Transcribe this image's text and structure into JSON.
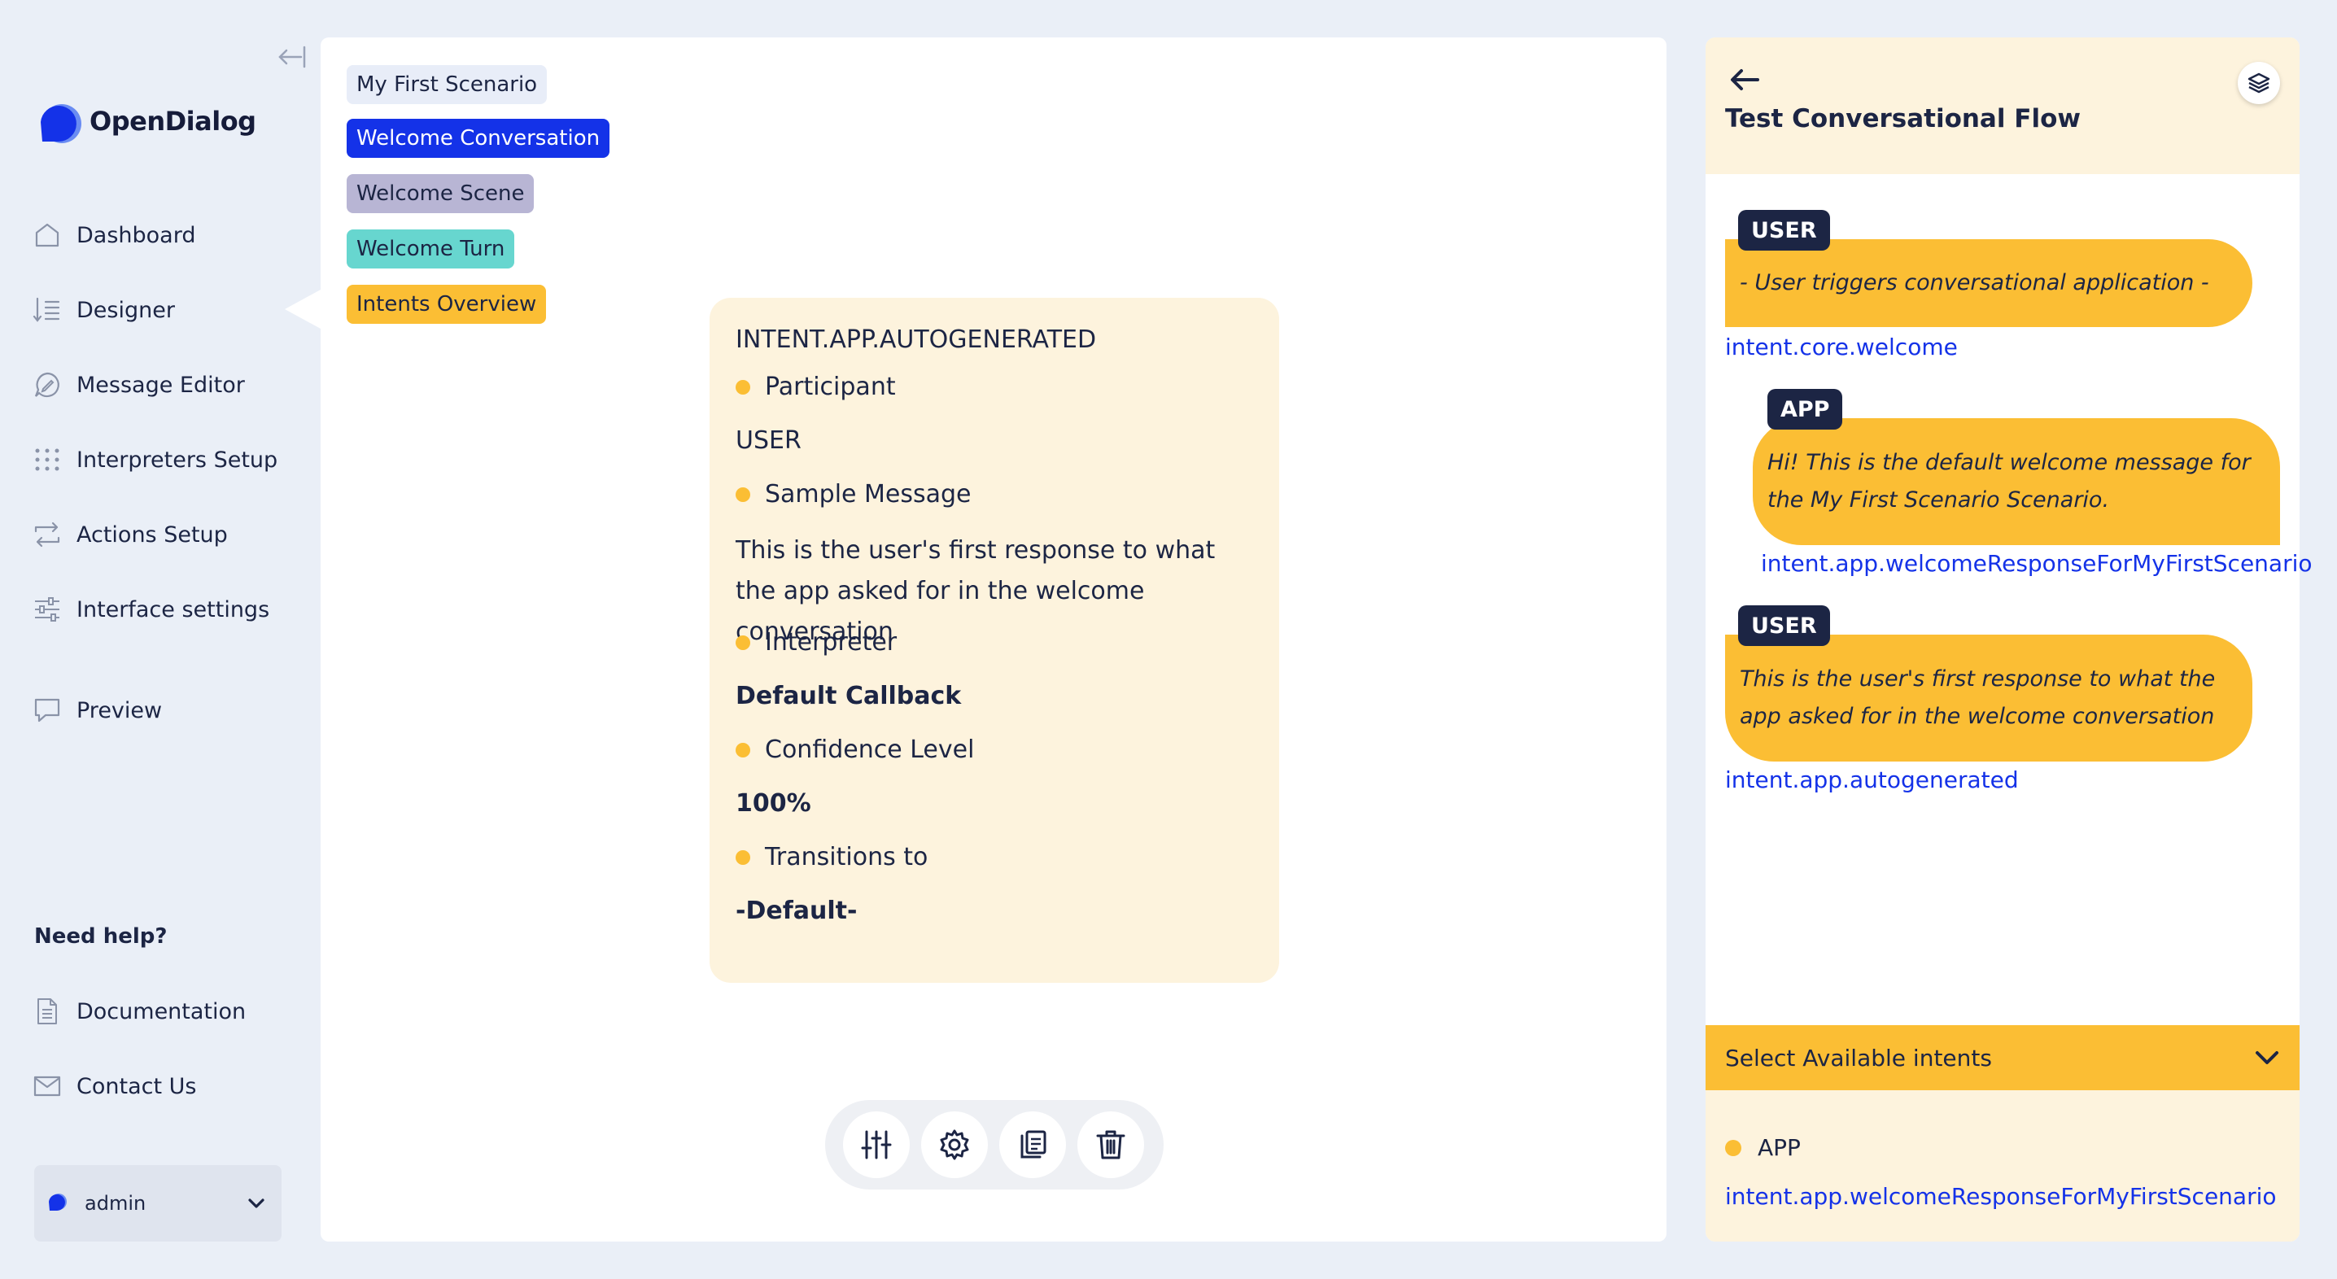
{
  "app": {
    "name": "OpenDialog",
    "accent_color": "#1432e8",
    "brand_yellow": "#fbbe34"
  },
  "sidebar": {
    "items": [
      {
        "label": "Dashboard",
        "icon": "home-icon"
      },
      {
        "label": "Designer",
        "icon": "list-icon",
        "active": true
      },
      {
        "label": "Message Editor",
        "icon": "chat-edit-icon"
      },
      {
        "label": "Interpreters Setup",
        "icon": "grid-dots-icon"
      },
      {
        "label": "Actions Setup",
        "icon": "arrows-loop-icon"
      },
      {
        "label": "Interface settings",
        "icon": "sliders-icon"
      },
      {
        "label": "Preview",
        "icon": "monitor-icon"
      }
    ],
    "help_title": "Need help?",
    "help_items": [
      {
        "label": "Documentation",
        "icon": "document-icon"
      },
      {
        "label": "Contact Us",
        "icon": "envelope-icon"
      }
    ],
    "user": {
      "name": "admin"
    }
  },
  "breadcrumbs": [
    {
      "label": "My First Scenario"
    },
    {
      "label": "Welcome Conversation"
    },
    {
      "label": "Welcome Scene"
    },
    {
      "label": "Welcome Turn"
    },
    {
      "label": "Intents Overview"
    }
  ],
  "intent_card": {
    "title": "INTENT.APP.AUTOGENERATED",
    "participant_label": "Participant",
    "participant_value": "USER",
    "sample_label": "Sample Message",
    "sample_value": "This is the user's first response to what the app asked for in the welcome conversation",
    "interpreter_label": "Interpreter",
    "interpreter_value": "Default Callback",
    "confidence_label": "Confidence Level",
    "confidence_value": "100%",
    "transitions_label": "Transitions to",
    "transitions_value": "-Default-"
  },
  "toolbar": {
    "buttons": [
      "sliders-icon",
      "gear-icon",
      "copy-icon",
      "trash-icon"
    ]
  },
  "test_panel": {
    "title": "Test Conversational Flow",
    "messages": [
      {
        "role": "USER",
        "text": "- User triggers conversational application -",
        "intent": "intent.core.welcome"
      },
      {
        "role": "APP",
        "text": "Hi! This is the default welcome message for the My First Scenario Scenario.",
        "intent": "intent.app.welcomeResponseForMyFirstScenario"
      },
      {
        "role": "USER",
        "text": "This is the user's first response to what the app asked for in the welcome conversation",
        "intent": "intent.app.autogenerated"
      }
    ],
    "select_label": "Select Available intents",
    "available": {
      "participant": "APP",
      "intent": "intent.app.welcomeResponseForMyFirstScenario"
    }
  }
}
